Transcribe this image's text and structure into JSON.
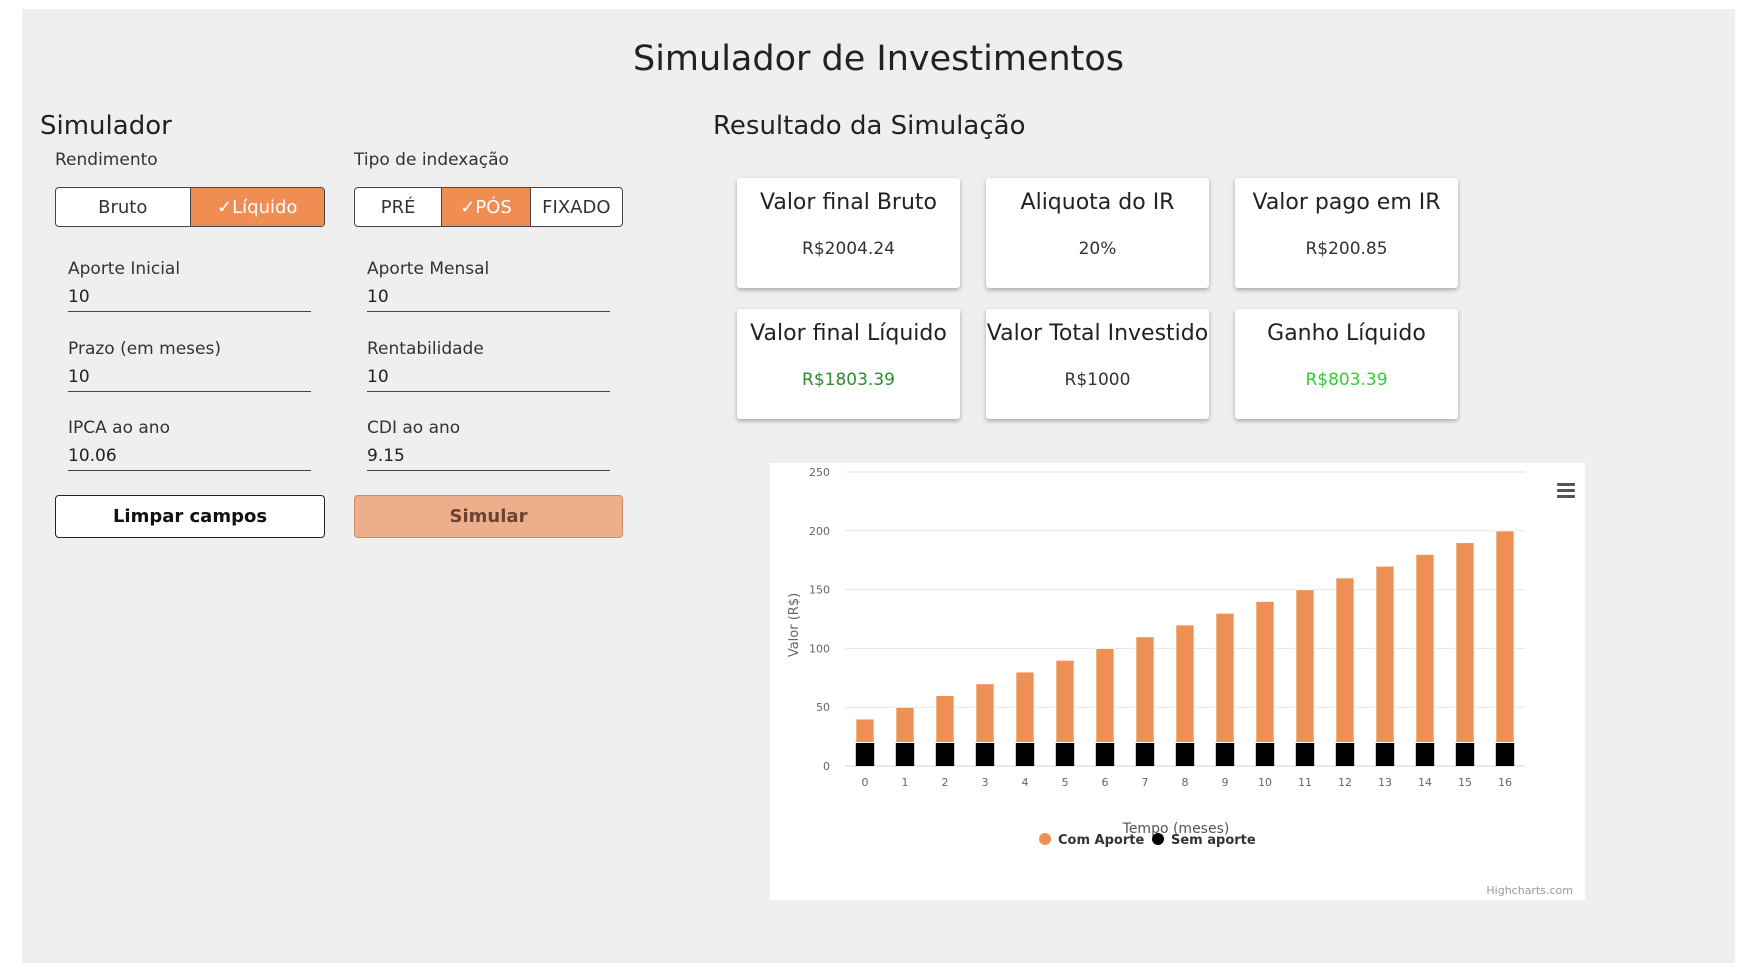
{
  "page": {
    "title": "Simulador de Investimentos"
  },
  "simulator": {
    "heading": "Simulador",
    "rendimento": {
      "label": "Rendimento",
      "options": [
        "Bruto",
        "✓Líquido"
      ],
      "selected": "✓Líquido"
    },
    "indexacao": {
      "label": "Tipo de indexação",
      "options": [
        "PRÉ",
        "✓PÓS",
        "FIXADO"
      ],
      "selected": "✓PÓS"
    },
    "fields": {
      "aporte_inicial": {
        "label": "Aporte Inicial",
        "value": "10"
      },
      "aporte_mensal": {
        "label": "Aporte Mensal",
        "value": "10"
      },
      "prazo": {
        "label": "Prazo (em meses)",
        "value": "10"
      },
      "rentabilidade": {
        "label": "Rentabilidade",
        "value": "10"
      },
      "ipca": {
        "label": "IPCA ao ano",
        "value": "10.06"
      },
      "cdi": {
        "label": "CDI ao ano",
        "value": "9.15"
      }
    },
    "clear_button": "Limpar campos",
    "simulate_button": "Simular"
  },
  "results": {
    "heading": "Resultado da Simulação",
    "cards": [
      {
        "title": "Valor final Bruto",
        "value": "R$2004.24",
        "color": "#333333"
      },
      {
        "title": "Aliquota do IR",
        "value": "20%",
        "color": "#333333"
      },
      {
        "title": "Valor pago em IR",
        "value": "R$200.85",
        "color": "#333333"
      },
      {
        "title": "Valor final Líquido",
        "value": "R$1803.39",
        "color": "#2e8b2e"
      },
      {
        "title": "Valor Total Investido",
        "value": "R$1000",
        "color": "#333333"
      },
      {
        "title": "Ganho Líquido",
        "value": "R$803.39",
        "color": "#33cc33"
      }
    ]
  },
  "chart_data": {
    "type": "bar",
    "stacked": true,
    "categories": [
      "0",
      "1",
      "2",
      "3",
      "4",
      "5",
      "6",
      "7",
      "8",
      "9",
      "10",
      "11",
      "12",
      "13",
      "14",
      "15",
      "16"
    ],
    "series": [
      {
        "name": "Com Aporte",
        "color": "#ef9155",
        "values": [
          20,
          30,
          40,
          50,
          60,
          70,
          80,
          90,
          100,
          110,
          120,
          130,
          140,
          150,
          160,
          170,
          180
        ]
      },
      {
        "name": "Sem aporte",
        "color": "#000000",
        "values": [
          20,
          20,
          20,
          20,
          20,
          20,
          20,
          20,
          20,
          20,
          20,
          20,
          20,
          20,
          20,
          20,
          20
        ]
      }
    ],
    "xlabel": "Tempo (meses)",
    "ylabel": "Valor (R$)",
    "ylim": [
      0,
      250
    ],
    "yticks": [
      0,
      50,
      100,
      150,
      200,
      250
    ],
    "grid": true,
    "legend_position": "bottom-center",
    "credits": "Highcharts.com",
    "menu_icon": "hamburger-menu-icon"
  }
}
